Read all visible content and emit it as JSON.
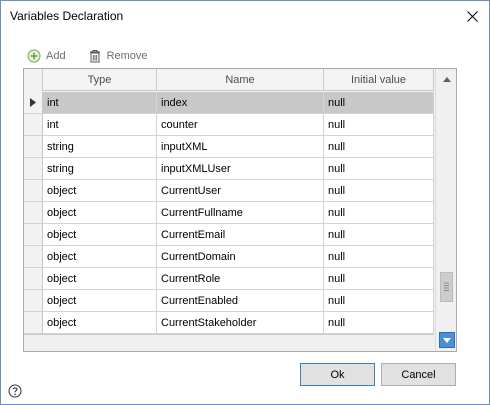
{
  "window": {
    "title": "Variables Declaration"
  },
  "toolbar": {
    "add_label": "Add",
    "remove_label": "Remove"
  },
  "grid": {
    "columns": [
      "Type",
      "Name",
      "Initial value"
    ],
    "rows": [
      {
        "type": "int",
        "name": "index",
        "initial": "null"
      },
      {
        "type": "int",
        "name": "counter",
        "initial": "null"
      },
      {
        "type": "string",
        "name": "inputXML",
        "initial": "null"
      },
      {
        "type": "string",
        "name": "inputXMLUser",
        "initial": "null"
      },
      {
        "type": "object",
        "name": "CurrentUser",
        "initial": "null"
      },
      {
        "type": "object",
        "name": "CurrentFullname",
        "initial": "null"
      },
      {
        "type": "object",
        "name": "CurrentEmail",
        "initial": "null"
      },
      {
        "type": "object",
        "name": "CurrentDomain",
        "initial": "null"
      },
      {
        "type": "object",
        "name": "CurrentRole",
        "initial": "null"
      },
      {
        "type": "object",
        "name": "CurrentEnabled",
        "initial": "null"
      },
      {
        "type": "object",
        "name": "CurrentStakeholder",
        "initial": "null"
      }
    ]
  },
  "buttons": {
    "ok": "Ok",
    "cancel": "Cancel"
  },
  "colors": {
    "accent": "#4a8fd8",
    "selected_row": "#c8c8c8"
  }
}
